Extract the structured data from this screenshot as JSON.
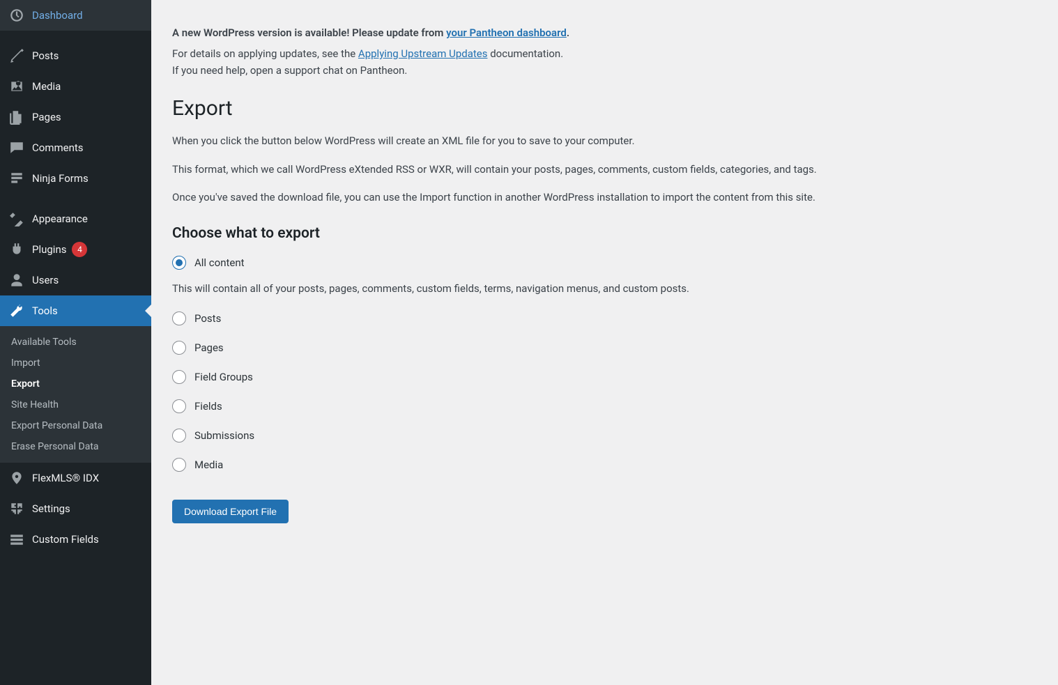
{
  "sidebar": {
    "items": [
      {
        "label": "Dashboard"
      },
      {
        "label": "Posts"
      },
      {
        "label": "Media"
      },
      {
        "label": "Pages"
      },
      {
        "label": "Comments"
      },
      {
        "label": "Ninja Forms"
      },
      {
        "label": "Appearance"
      },
      {
        "label": "Plugins",
        "badge": "4"
      },
      {
        "label": "Users"
      },
      {
        "label": "Tools"
      },
      {
        "label": "FlexMLS® IDX"
      },
      {
        "label": "Settings"
      },
      {
        "label": "Custom Fields"
      }
    ],
    "submenu": {
      "items": [
        {
          "label": "Available Tools"
        },
        {
          "label": "Import"
        },
        {
          "label": "Export"
        },
        {
          "label": "Site Health"
        },
        {
          "label": "Export Personal Data"
        },
        {
          "label": "Erase Personal Data"
        }
      ]
    }
  },
  "notice": {
    "line1_prefix": "A new WordPress version is available! Please update from ",
    "line1_link": "your Pantheon dashboard",
    "line1_suffix": ".",
    "line2_prefix": "For details on applying updates, see the ",
    "line2_link": "Applying Upstream Updates",
    "line2_suffix": " documentation.",
    "line3": "If you need help, open a support chat on Pantheon."
  },
  "page": {
    "title": "Export",
    "desc1": "When you click the button below WordPress will create an XML file for you to save to your computer.",
    "desc2": "This format, which we call WordPress eXtended RSS or WXR, will contain your posts, pages, comments, custom fields, categories, and tags.",
    "desc3": "Once you've saved the download file, you can use the Import function in another WordPress installation to import the content from this site.",
    "section_title": "Choose what to export",
    "options": [
      {
        "label": "All content",
        "checked": true,
        "desc": "This will contain all of your posts, pages, comments, custom fields, terms, navigation menus, and custom posts."
      },
      {
        "label": "Posts"
      },
      {
        "label": "Pages"
      },
      {
        "label": "Field Groups"
      },
      {
        "label": "Fields"
      },
      {
        "label": "Submissions"
      },
      {
        "label": "Media"
      }
    ],
    "download_button": "Download Export File"
  }
}
